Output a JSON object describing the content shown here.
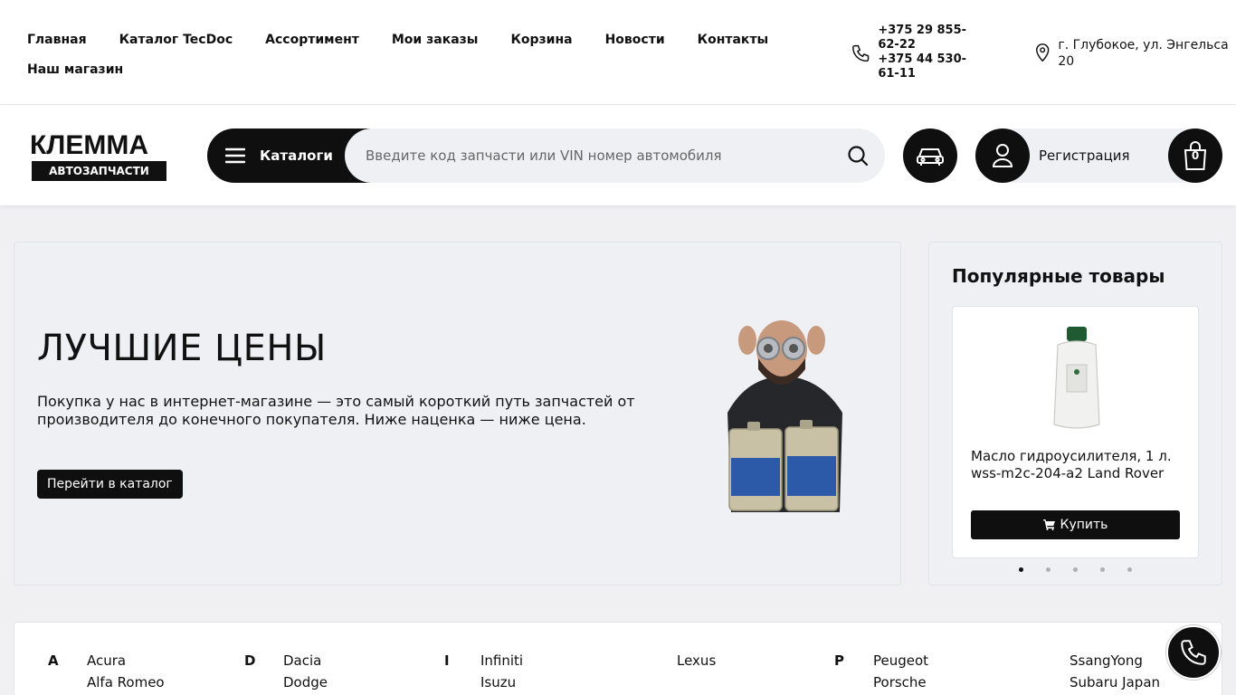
{
  "topnav": {
    "items": [
      "Главная",
      "Каталог TecDoc",
      "Ассортимент",
      "Мои заказы",
      "Корзина",
      "Новости",
      "Контакты"
    ],
    "row2": "Наш магазин"
  },
  "contacts": {
    "phone1": "+375 29 855-62-22",
    "phone2": "+375 44 530-61-11",
    "address": "г. Глубокое, ул. Энгельса 20"
  },
  "logo": {
    "top": "КЛЕММА",
    "bottom": "АВТОЗАПЧАСТИ"
  },
  "header": {
    "catalogs_label": "Каталоги",
    "search_placeholder": "Введите код запчасти или VIN номер автомобиля",
    "register_label": "Регистрация",
    "cart_count": "0"
  },
  "hero": {
    "title": "ЛУЧШИЕ ЦЕНЫ",
    "text": "Покупка у нас в интернет-магазине — это самый короткий путь запчастей от производителя до конечного покупателя. Ниже наценка — ниже цена.",
    "cta": "Перейти в каталог"
  },
  "popular": {
    "title": "Популярные товары",
    "product_name": "Масло гидроусилителя, 1 л. wss-m2c-204-a2 Land Rover",
    "buy_label": "Купить",
    "dots_count": 5,
    "active_dot": 0
  },
  "brands": {
    "groups": [
      {
        "letter": "A",
        "names": [
          "Acura",
          "Alfa Romeo"
        ]
      },
      {
        "letter": "D",
        "names": [
          "Dacia",
          "Dodge"
        ]
      },
      {
        "letter": "I",
        "names": [
          "Infiniti",
          "Isuzu"
        ]
      },
      {
        "letter": "",
        "names": [
          "Lexus"
        ]
      },
      {
        "letter": "P",
        "names": [
          "Peugeot",
          "Porsche"
        ]
      },
      {
        "letter": "",
        "names": [
          "SsangYong",
          "Subaru Japan"
        ]
      }
    ]
  }
}
